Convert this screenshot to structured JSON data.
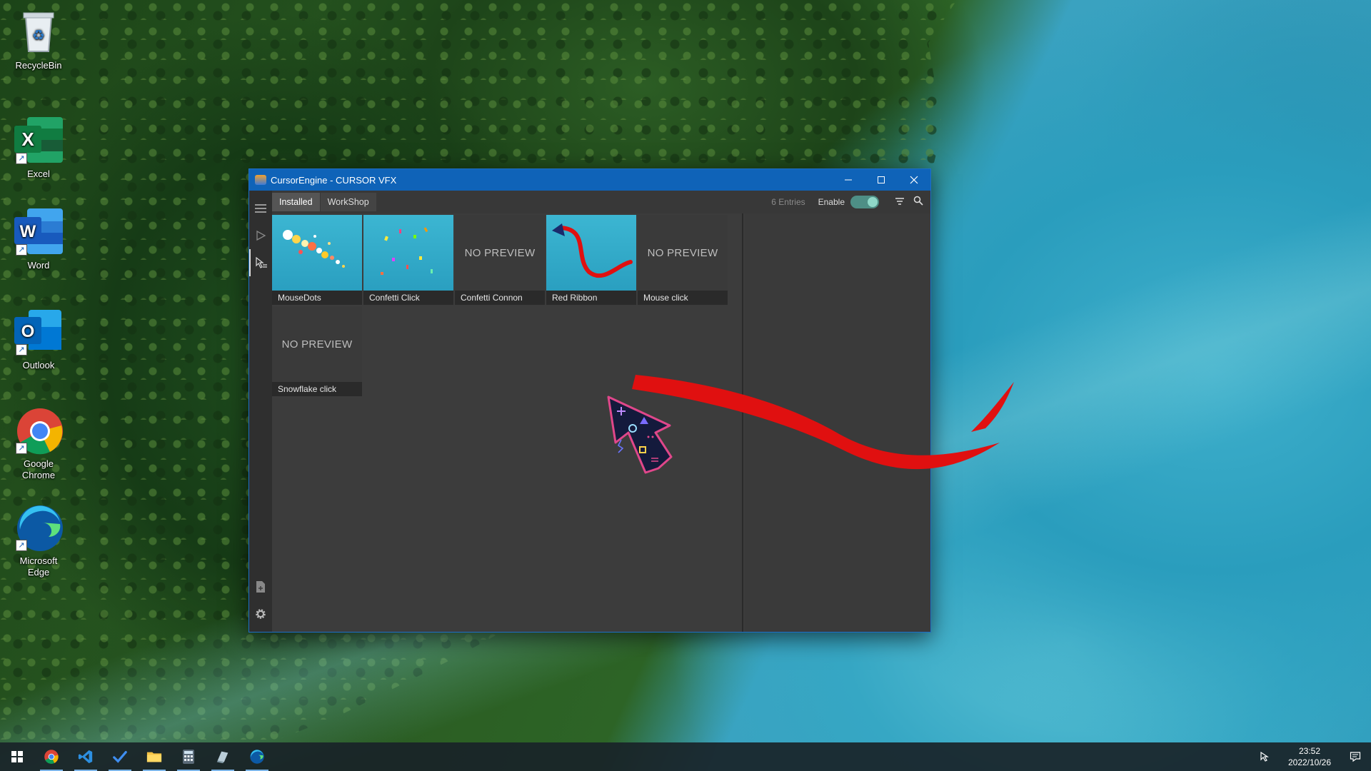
{
  "desktop": {
    "icons": [
      {
        "label": "RecycleBin"
      },
      {
        "label": "Excel"
      },
      {
        "label": "Word"
      },
      {
        "label": "Outlook"
      },
      {
        "label": "Google\nChrome",
        "line1": "Google",
        "line2": "Chrome"
      },
      {
        "label": "Microsoft Edge",
        "line1": "Microsoft",
        "line2": "Edge"
      }
    ]
  },
  "window": {
    "title": "CursorEngine - CURSOR VFX",
    "tabs": [
      {
        "label": "Installed"
      },
      {
        "label": "WorkShop"
      }
    ],
    "entries": "6 Entries",
    "enable_label": "Enable",
    "enable_on": true,
    "no_preview": "NO PREVIEW",
    "cards": [
      {
        "label": "MouseDots",
        "preview": true
      },
      {
        "label": "Confetti Click",
        "preview": true
      },
      {
        "label": "Confetti Connon",
        "preview": false
      },
      {
        "label": "Red Ribbon",
        "preview": true
      },
      {
        "label": "Mouse click",
        "preview": false
      },
      {
        "label": "Snowflake click",
        "preview": false
      }
    ]
  },
  "taskbar": {
    "time": "23:52",
    "date": "2022/10/26"
  },
  "colors": {
    "titlebar": "#0f63b8",
    "ribbon": "#e01010",
    "toggle": "#4e8f86"
  }
}
